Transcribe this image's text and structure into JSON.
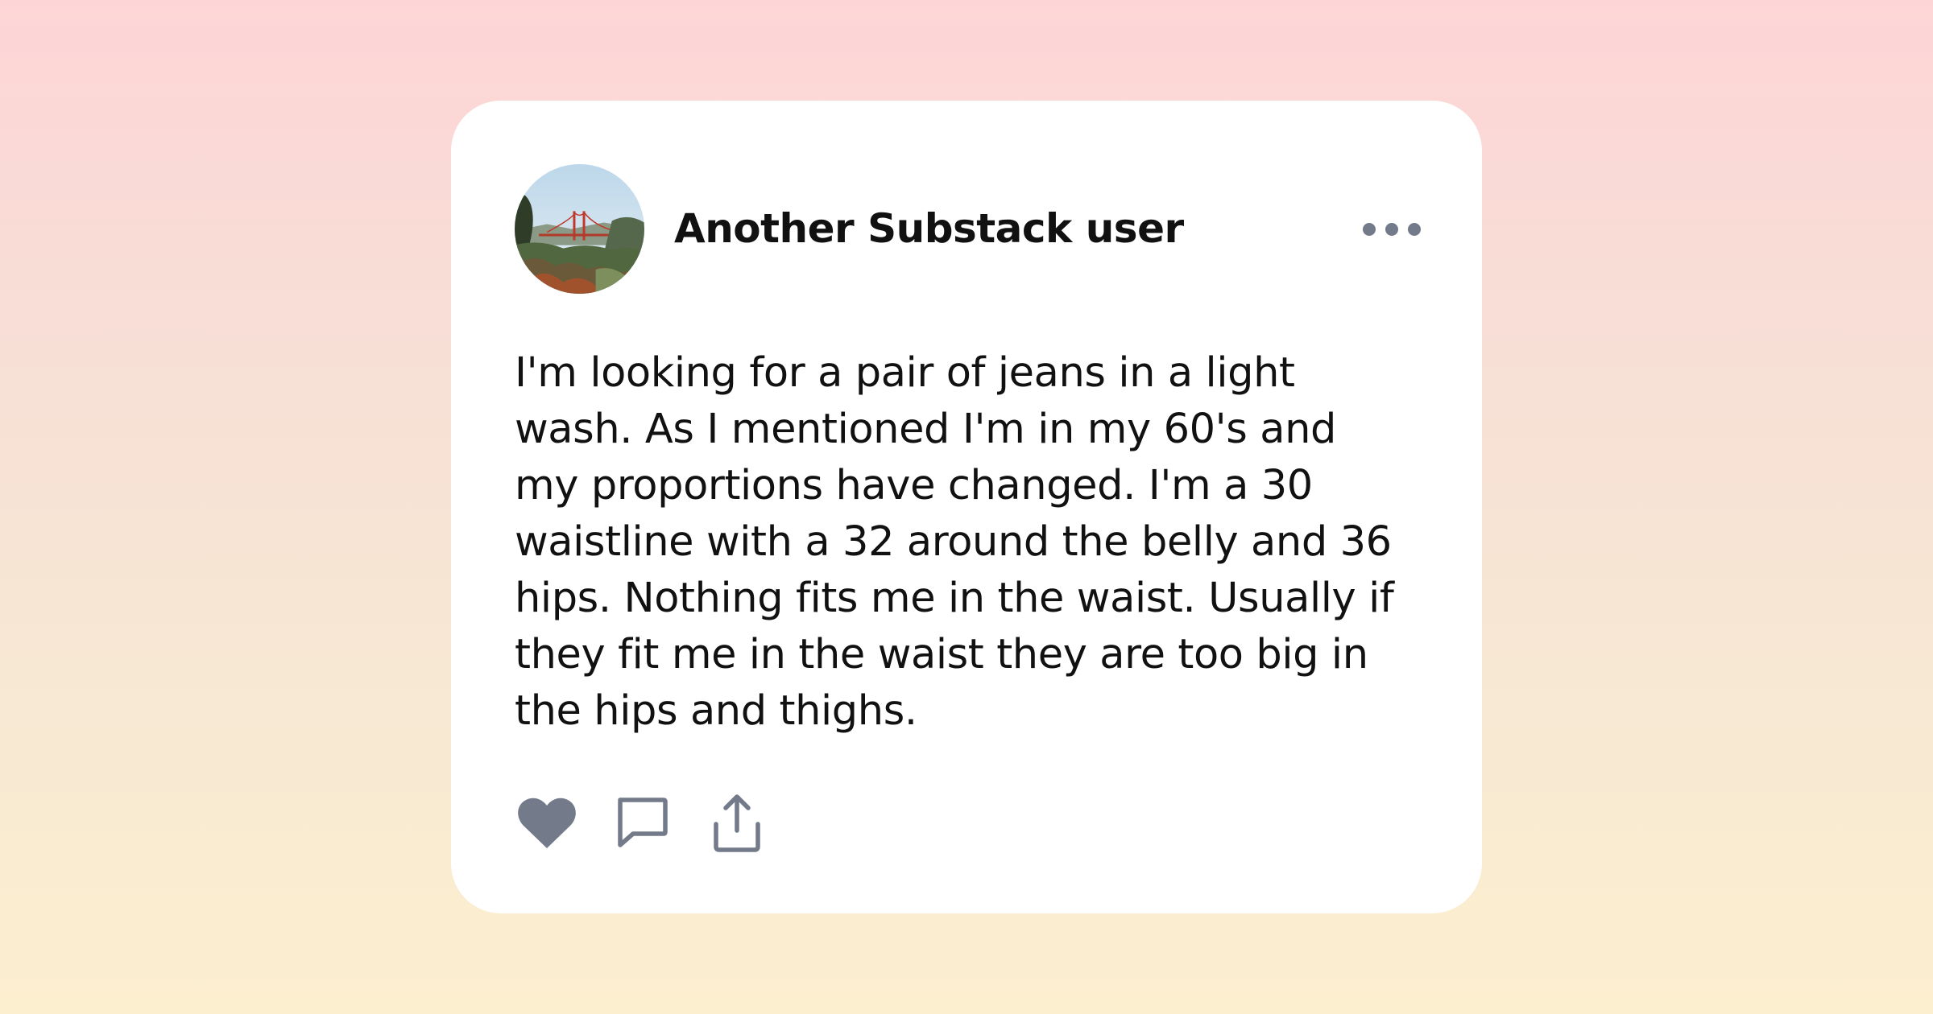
{
  "post": {
    "author_name": "Another Substack user",
    "body_lines": [
      "I'm looking for a pair of jeans in a light",
      "wash. As I mentioned I'm in my 60's and",
      "my proportions have changed. I'm a 30",
      "waistline with a 32 around the belly and 36",
      "hips. Nothing fits me in the waist. Usually if",
      "they fit me in the waist they are too big in",
      "the hips and thighs."
    ]
  },
  "icons": {
    "avatar": "golden-gate-bridge-photo",
    "more": "ellipsis-icon",
    "like": "heart-icon",
    "comment": "speech-bubble-icon",
    "share": "share-upload-icon"
  },
  "colors": {
    "icon": "#737b8a",
    "text": "#111111",
    "card": "#ffffff",
    "gradient_top": "#fdd5d6",
    "gradient_bottom": "#fcefcf"
  }
}
